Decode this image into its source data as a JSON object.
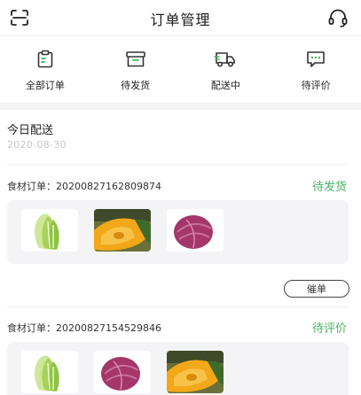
{
  "header": {
    "title": "订单管理",
    "left_icon": "scan-icon",
    "right_icon": "headset-icon"
  },
  "status_nav": [
    {
      "label": "全部订单",
      "icon": "clipboard-icon"
    },
    {
      "label": "待发货",
      "icon": "box-icon"
    },
    {
      "label": "配送中",
      "icon": "delivery-truck-icon"
    },
    {
      "label": "待评价",
      "icon": "comment-icon"
    }
  ],
  "today": {
    "heading": "今日配送",
    "date": "2020-08-30"
  },
  "orders": [
    {
      "order_no": "食材订单：20200827162809874",
      "status": "待发货",
      "goods": [
        "napa-cabbage",
        "pumpkin",
        "red-cabbage"
      ],
      "action": "催单"
    },
    {
      "order_no": "食材订单：20200827154529846",
      "status": "待评价",
      "goods": [
        "napa-cabbage",
        "red-cabbage",
        "pumpkin"
      ]
    }
  ],
  "colors": {
    "accent_green": "#46b563",
    "card_bg": "#f4f4f6",
    "muted_text": "#c6c6c6",
    "section_gray": "#f4f4f4"
  }
}
